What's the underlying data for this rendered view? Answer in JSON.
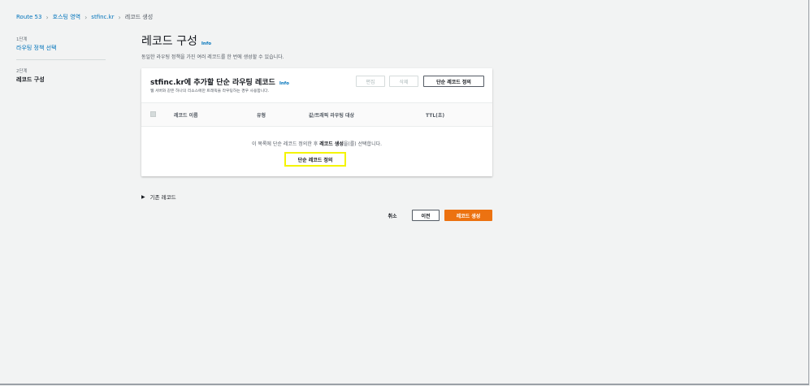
{
  "breadcrumb": {
    "items": [
      "Route 53",
      "호스팅 영역",
      "stfinc.kr"
    ],
    "current": "레코드 생성"
  },
  "steps": [
    {
      "label": "1단계",
      "title": "라우팅 정책 선택"
    },
    {
      "label": "2단계",
      "title": "레코드 구성"
    }
  ],
  "page": {
    "title": "레코드 구성",
    "info": "Info",
    "description": "동일한 라우팅 정책을 가진 여러 레코드를 한 번에 생성할 수 있습니다."
  },
  "panel": {
    "title": "stfinc.kr에 추가할 단순 라우팅 레코드",
    "info": "Info",
    "subtitle": "웹 서버와 같은 하나의 리소스에만 트래픽을 라우팅하는 경우 사용합니다.",
    "buttons": {
      "edit": "편집",
      "delete": "삭제",
      "define": "단순 레코드 정의"
    },
    "columns": [
      "레코드 이름",
      "유형",
      "값/트래픽 라우팅 대상",
      "TTL(초)"
    ],
    "empty": {
      "prefix": "이 목록에 단순 레코드 정의한 후 ",
      "bold": "레코드 생성",
      "suffix": "을(를) 선택합니다."
    },
    "empty_button": "단순 레코드 정의"
  },
  "existing_records": {
    "icon": "caret-right-icon",
    "label": "기존 레코드"
  },
  "footer": {
    "cancel": "취소",
    "previous": "이전",
    "create": "레코드 생성"
  },
  "colors": {
    "accent": "#ec7211",
    "link": "#0073bb",
    "highlight": "#f4f400"
  }
}
